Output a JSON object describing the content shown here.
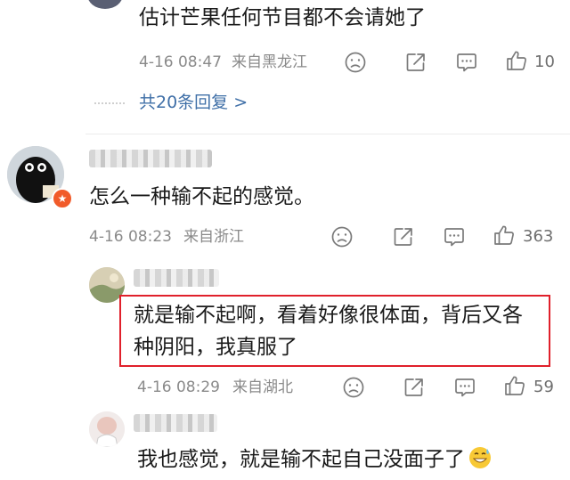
{
  "comments": [
    {
      "text": "估计芒果任何节目都不会请她了",
      "time": "4-16 08:47",
      "location": "来自黑龙江",
      "likes": "10",
      "replies_link": "共20条回复 >"
    },
    {
      "text": "怎么一种输不起的感觉。",
      "time": "4-16 08:23",
      "location": "来自浙江",
      "likes": "363"
    },
    {
      "text_line1": "就是输不起啊，看着好像很体面，背后又各",
      "text_line2": "种阴阳，我真服了",
      "time": "4-16 08:29",
      "location": "来自湖北",
      "likes": "59"
    },
    {
      "text": "我也感觉，就是输不起自己没面子了"
    }
  ],
  "colors": {
    "highlight_border": "#e0202b",
    "link": "#3f6fa7",
    "meta": "#8a8a8a"
  },
  "icons": [
    "dislike-icon",
    "share-icon",
    "comment-icon",
    "like-icon",
    "grinning-sweat-emoji"
  ]
}
